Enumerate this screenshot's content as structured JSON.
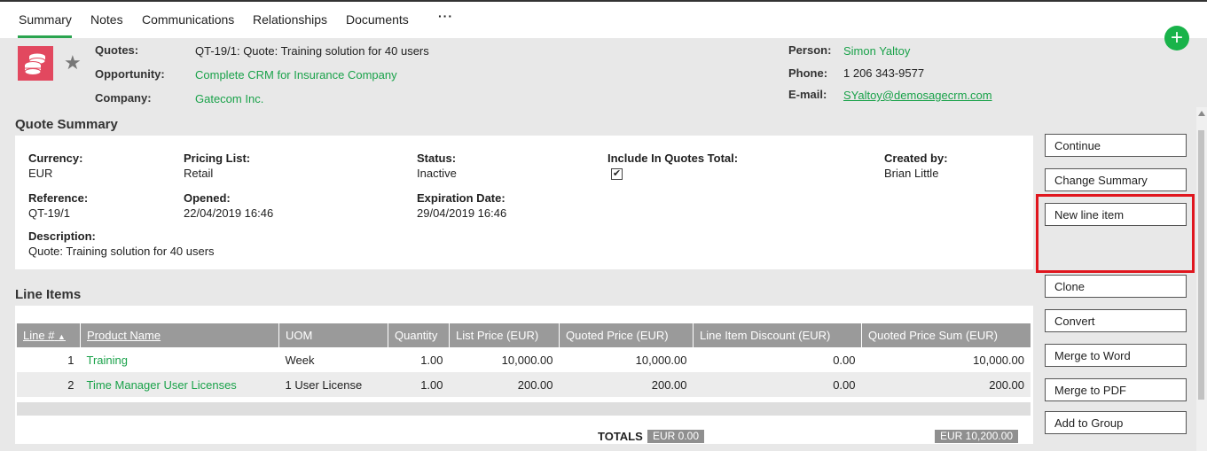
{
  "tabs": [
    {
      "label": "Summary",
      "active": true
    },
    {
      "label": "Notes"
    },
    {
      "label": "Communications"
    },
    {
      "label": "Relationships"
    },
    {
      "label": "Documents"
    }
  ],
  "tabs_more": "···",
  "add_button": "+",
  "header": {
    "quotes_label": "Quotes:",
    "quotes_value": "QT-19/1: Quote: Training solution for 40 users",
    "opportunity_label": "Opportunity:",
    "opportunity_value": "Complete CRM for Insurance Company",
    "company_label": "Company:",
    "company_value": "Gatecom Inc.",
    "person_label": "Person:",
    "person_value": "Simon Yaltoy",
    "phone_label": "Phone:",
    "phone_value": "1 206 343-9577",
    "email_label": "E-mail:",
    "email_value": "SYaltoy@demosagecrm.com"
  },
  "quote_summary": {
    "title": "Quote Summary",
    "currency_label": "Currency:",
    "currency_value": "EUR",
    "pricing_list_label": "Pricing List:",
    "pricing_list_value": "Retail",
    "status_label": "Status:",
    "status_value": "Inactive",
    "include_label": "Include In Quotes Total:",
    "include_checked": "✔",
    "created_by_label": "Created by:",
    "created_by_value": "Brian Little",
    "reference_label": "Reference:",
    "reference_value": "QT-19/1",
    "opened_label": "Opened:",
    "opened_value": "22/04/2019 16:46",
    "expiration_label": "Expiration Date:",
    "expiration_value": "29/04/2019 16:46",
    "description_label": "Description:",
    "description_value": "Quote: Training solution for 40 users"
  },
  "line_items": {
    "title": "Line Items",
    "columns": [
      "Line #",
      "Product Name",
      "UOM",
      "Quantity",
      "List Price (EUR)",
      "Quoted Price (EUR)",
      "Line Item Discount (EUR)",
      "Quoted Price Sum (EUR)"
    ],
    "rows": [
      [
        "1",
        "Training",
        "Week",
        "1.00",
        "10,000.00",
        "10,000.00",
        "0.00",
        "10,000.00"
      ],
      [
        "2",
        "Time Manager User Licenses",
        "1 User License",
        "1.00",
        "200.00",
        "200.00",
        "0.00",
        "200.00"
      ]
    ],
    "totals_label": "TOTALS",
    "total_discount": "EUR 0.00",
    "total_sum": "EUR 10,200.00"
  },
  "actions": [
    "Continue",
    "Change Summary",
    "New line item",
    "Clone",
    "Convert",
    "Merge to Word",
    "Merge to PDF",
    "Add to Group"
  ],
  "highlight_color": "#e0161e",
  "accent_color": "#1aa24a"
}
